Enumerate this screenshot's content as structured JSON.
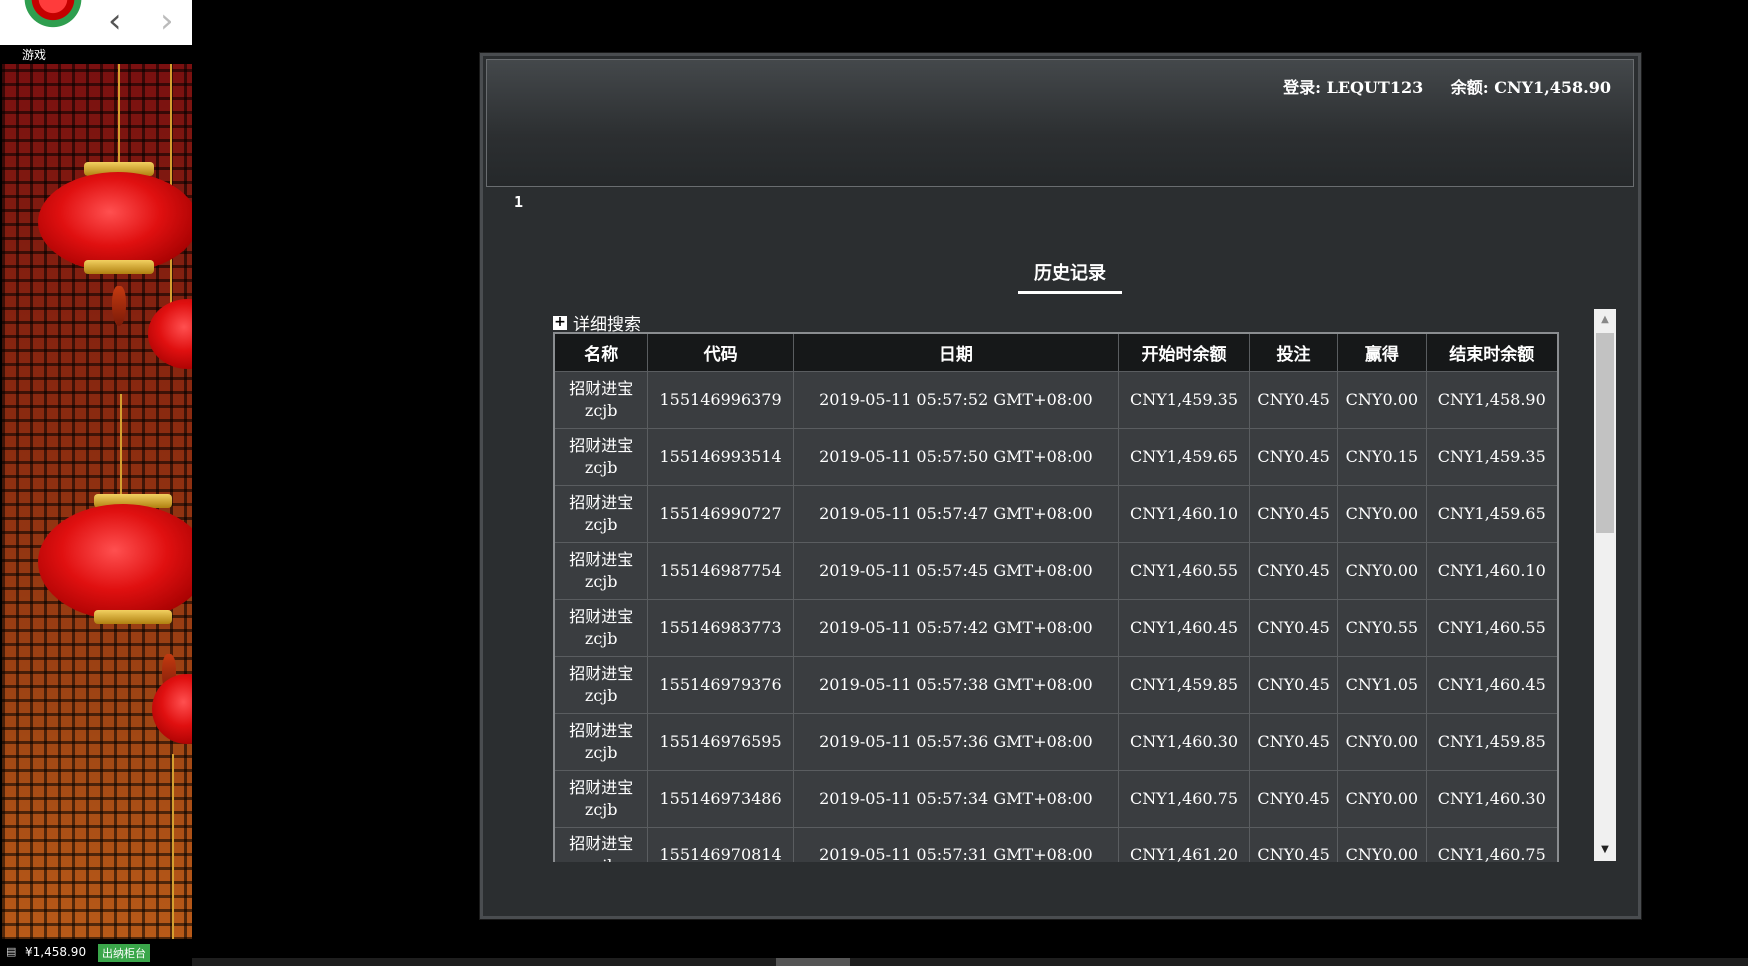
{
  "sidebar": {
    "game_label": "游戏",
    "wallet_balance": "¥1,458.90",
    "cashier_label": "出纳柜台"
  },
  "header": {
    "login": "登录: LEQUT123",
    "balance": "余额: CNY1,458.90"
  },
  "page_number": "1",
  "history_title": "历史记录",
  "search_toggle_label": "详细搜索",
  "table": {
    "columns": [
      "名称",
      "代码",
      "日期",
      "开始时余额",
      "投注",
      "赢得",
      "结束时余额"
    ],
    "rows": [
      {
        "name_cn": "招财进宝",
        "name_code": "zcjb",
        "code": "155146996379",
        "date": "2019-05-11 05:57:52 GMT+08:00",
        "start": "CNY1,459.35",
        "bet": "CNY0.45",
        "win": "CNY0.00",
        "end": "CNY1,458.90"
      },
      {
        "name_cn": "招财进宝",
        "name_code": "zcjb",
        "code": "155146993514",
        "date": "2019-05-11 05:57:50 GMT+08:00",
        "start": "CNY1,459.65",
        "bet": "CNY0.45",
        "win": "CNY0.15",
        "end": "CNY1,459.35"
      },
      {
        "name_cn": "招财进宝",
        "name_code": "zcjb",
        "code": "155146990727",
        "date": "2019-05-11 05:57:47 GMT+08:00",
        "start": "CNY1,460.10",
        "bet": "CNY0.45",
        "win": "CNY0.00",
        "end": "CNY1,459.65"
      },
      {
        "name_cn": "招财进宝",
        "name_code": "zcjb",
        "code": "155146987754",
        "date": "2019-05-11 05:57:45 GMT+08:00",
        "start": "CNY1,460.55",
        "bet": "CNY0.45",
        "win": "CNY0.00",
        "end": "CNY1,460.10"
      },
      {
        "name_cn": "招财进宝",
        "name_code": "zcjb",
        "code": "155146983773",
        "date": "2019-05-11 05:57:42 GMT+08:00",
        "start": "CNY1,460.45",
        "bet": "CNY0.45",
        "win": "CNY0.55",
        "end": "CNY1,460.55"
      },
      {
        "name_cn": "招财进宝",
        "name_code": "zcjb",
        "code": "155146979376",
        "date": "2019-05-11 05:57:38 GMT+08:00",
        "start": "CNY1,459.85",
        "bet": "CNY0.45",
        "win": "CNY1.05",
        "end": "CNY1,460.45"
      },
      {
        "name_cn": "招财进宝",
        "name_code": "zcjb",
        "code": "155146976595",
        "date": "2019-05-11 05:57:36 GMT+08:00",
        "start": "CNY1,460.30",
        "bet": "CNY0.45",
        "win": "CNY0.00",
        "end": "CNY1,459.85"
      },
      {
        "name_cn": "招财进宝",
        "name_code": "zcjb",
        "code": "155146973486",
        "date": "2019-05-11 05:57:34 GMT+08:00",
        "start": "CNY1,460.75",
        "bet": "CNY0.45",
        "win": "CNY0.00",
        "end": "CNY1,460.30"
      },
      {
        "name_cn": "招财进宝",
        "name_code": "zcjb",
        "code": "155146970814",
        "date": "2019-05-11 05:57:31 GMT+08:00",
        "start": "CNY1,461.20",
        "bet": "CNY0.45",
        "win": "CNY0.00",
        "end": "CNY1,460.75"
      }
    ]
  },
  "icons": {
    "back": "chevron-left-icon",
    "forward": "chevron-right-icon",
    "expand": "plus-box-icon",
    "wallet": "wallet-icon"
  },
  "colors": {
    "cashier_green": "#3aa64a",
    "window_bg": "#2b2e30",
    "header_cell_bg": "#161819",
    "row_bg": "#3a3d40"
  }
}
